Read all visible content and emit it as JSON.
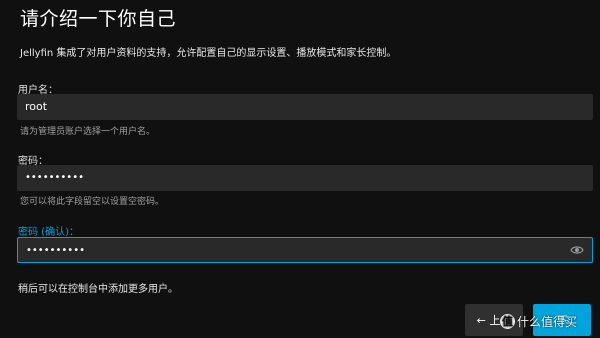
{
  "header": {
    "title": "请介绍一下你自己"
  },
  "intro_text": "Jellyfin 集成了对用户资料的支持，允许配置自己的显示设置、播放模式和家长控制。",
  "form": {
    "username": {
      "label": "用户名：",
      "value": "root",
      "hint": "请为管理员账户选择一个用户名。"
    },
    "password": {
      "label": "密码：",
      "value": "••••••••••",
      "hint": "您可以将此字段留空以设置空密码。"
    },
    "password_confirm": {
      "label": "密码 (确认)：",
      "value": "••••••••••",
      "icon": "eye-icon"
    }
  },
  "note": "稍后可以在控制台中添加更多用户。",
  "buttons": {
    "prev_label": "← 上一",
    "next_label": "下"
  },
  "watermark": {
    "badge": "值",
    "text": "什么值得买"
  },
  "colors": {
    "accent": "#00a4dc",
    "background": "#101010",
    "input_bg": "#292929"
  }
}
